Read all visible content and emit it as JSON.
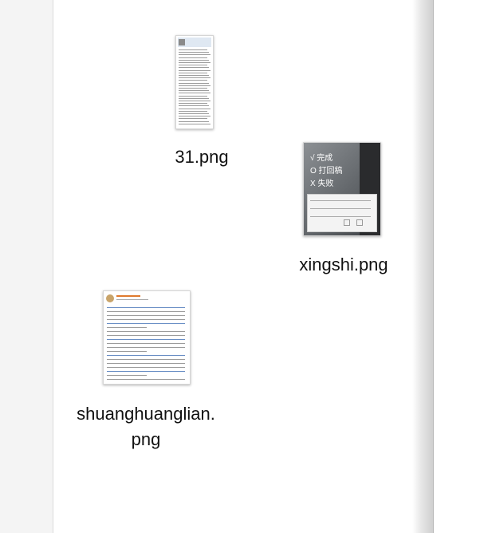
{
  "files": [
    {
      "name": "31.png",
      "thumb_icon": "document-thumbnail-icon"
    },
    {
      "name": "xingshi.png",
      "thumb_icon": "photo-thumbnail-icon",
      "overlay_lines": [
        "√ 完成",
        "O 打回稿",
        "X 失败"
      ]
    },
    {
      "name": "shuanghuanglian.\npng",
      "thumb_icon": "weibo-post-thumbnail-icon"
    }
  ],
  "colors": {
    "canvas": "#ffffff",
    "label_text": "#111111",
    "panel_shadow": "#cfcfcf"
  }
}
